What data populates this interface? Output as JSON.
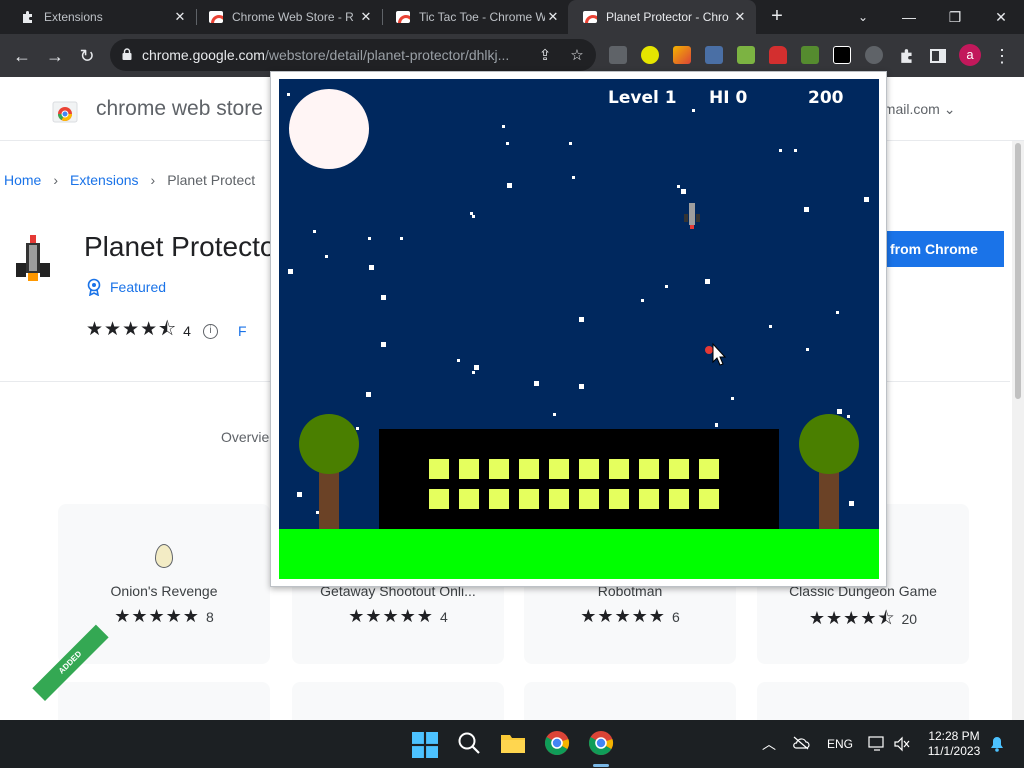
{
  "browser": {
    "tabs": [
      {
        "label": "Extensions",
        "icon": "puzzle-icon",
        "active": false
      },
      {
        "label": "Chrome Web Store - R",
        "icon": "chrome-web-store-icon",
        "active": false
      },
      {
        "label": "Tic Tac Toe - Chrome W",
        "icon": "chrome-web-store-icon",
        "active": false
      },
      {
        "label": "Planet Protector - Chro",
        "icon": "chrome-web-store-icon",
        "active": true
      }
    ],
    "url_host": "chrome.google.com",
    "url_path": "/webstore/detail/planet-protector/dhlkj..."
  },
  "store": {
    "title": "chrome web store",
    "account": "gmail.com",
    "breadcrumb": [
      "Home",
      "Extensions",
      "Planet Protect"
    ],
    "app_name": "Planet Protecto",
    "featured": "Featured",
    "rating_value": "4",
    "rating_stars": "★★★★⯪",
    "rating_link": "F",
    "remove_button": "from Chrome",
    "overview_tab": "Overvie",
    "cards": [
      {
        "title": "Onion's Revenge",
        "stars": "★★★★★",
        "count": "8"
      },
      {
        "title": "Getaway Shootout Onli...",
        "stars": "★★★★★",
        "count": "4"
      },
      {
        "title": "Robotman",
        "stars": "★★★★★",
        "count": "6"
      },
      {
        "title": "Classic Dungeon Game",
        "stars": "★★★★⯪",
        "count": "20"
      }
    ],
    "added_ribbon": "ADDED"
  },
  "game": {
    "level": "Level 1",
    "hi_score": "HI 0",
    "score": "200",
    "colors": {
      "sky": "#00285e",
      "grass": "#00ff00",
      "window": "#e5ff5e",
      "tree": "#4a7f00",
      "trunk": "#6b4226",
      "moon": "#fff5f5"
    }
  },
  "taskbar": {
    "language": "ENG",
    "time": "12:28 PM",
    "date": "11/1/2023"
  }
}
